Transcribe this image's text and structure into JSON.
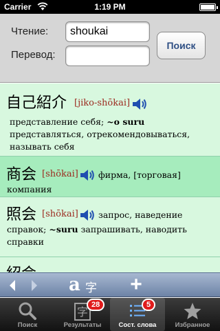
{
  "status_bar": {
    "carrier": "Carrier",
    "time": "1:19 PM"
  },
  "search_form": {
    "reading_label": "Чтение:",
    "reading_value": "shoukai",
    "translation_label": "Перевод:",
    "translation_value": "",
    "search_button": "Поиск"
  },
  "entries": [
    {
      "kanji": "自己紹介",
      "reading": "[jiko-shōkai]",
      "lines": [
        "представление себя; ",
        "~o suru",
        "представляться, отрекомендовываться,",
        "называть себя"
      ]
    },
    {
      "kanji": "商会",
      "reading": "[shōkai]",
      "inline": "фирма, [торговая]",
      "lines": [
        "компания"
      ]
    },
    {
      "kanji": "照会",
      "reading": "[shōkai]",
      "inline": "запрос, наведение",
      "lines": [
        "справок; ",
        "~suru",
        " запрашивать, наводить",
        "справки"
      ]
    },
    {
      "kanji": "紹会"
    }
  ],
  "toolbar": {
    "font_latin": "a",
    "font_kanji": "字",
    "add": "+"
  },
  "tabs": [
    {
      "label": "Поиск",
      "icon": "magnifier-icon",
      "badge": ""
    },
    {
      "label": "Результаты",
      "icon": "kanji-card-icon",
      "badge": "28",
      "icon_glyph": "字"
    },
    {
      "label": "Сост. слова",
      "icon": "list-icon",
      "badge": "5",
      "active": true
    },
    {
      "label": "Избранное",
      "icon": "star-icon",
      "badge": ""
    }
  ],
  "colors": {
    "entry_bg": "#d8f8df",
    "entry_selected_bg": "#a6ecbd",
    "reading_color": "#9c2a1f",
    "toolbar": "#8ea0bf",
    "badge": "#e01b1b"
  }
}
